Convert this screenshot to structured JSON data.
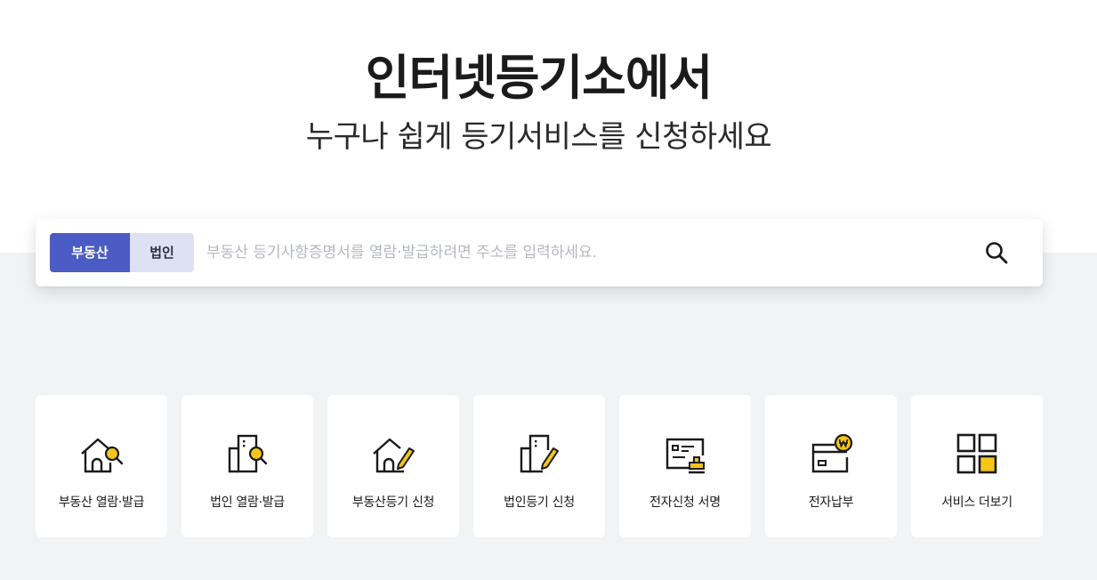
{
  "hero": {
    "title": "인터넷등기소에서",
    "subtitle": "누구나 쉽게 등기서비스를 신청하세요"
  },
  "search": {
    "tabs": [
      {
        "label": "부동산",
        "active": true
      },
      {
        "label": "법인",
        "active": false
      }
    ],
    "placeholder": "부동산 등기사항증명서를 열람·발급하려면 주소를 입력하세요.",
    "value": "",
    "button_icon": "search-icon"
  },
  "services": [
    {
      "label": "부동산 열람·발급",
      "icon": "house-search-icon"
    },
    {
      "label": "법인 열람·발급",
      "icon": "building-search-icon"
    },
    {
      "label": "부동산등기 신청",
      "icon": "house-pencil-icon"
    },
    {
      "label": "법인등기 신청",
      "icon": "building-pencil-icon"
    },
    {
      "label": "전자신청 서명",
      "icon": "document-stamp-icon"
    },
    {
      "label": "전자납부",
      "icon": "card-won-icon"
    },
    {
      "label": "서비스 더보기",
      "icon": "grid-more-icon"
    }
  ],
  "colors": {
    "accent": "#4a5bc4",
    "tab_inactive": "#dde1f2",
    "icon_yellow": "#f5c518",
    "background_gray": "#f2f3f5"
  }
}
